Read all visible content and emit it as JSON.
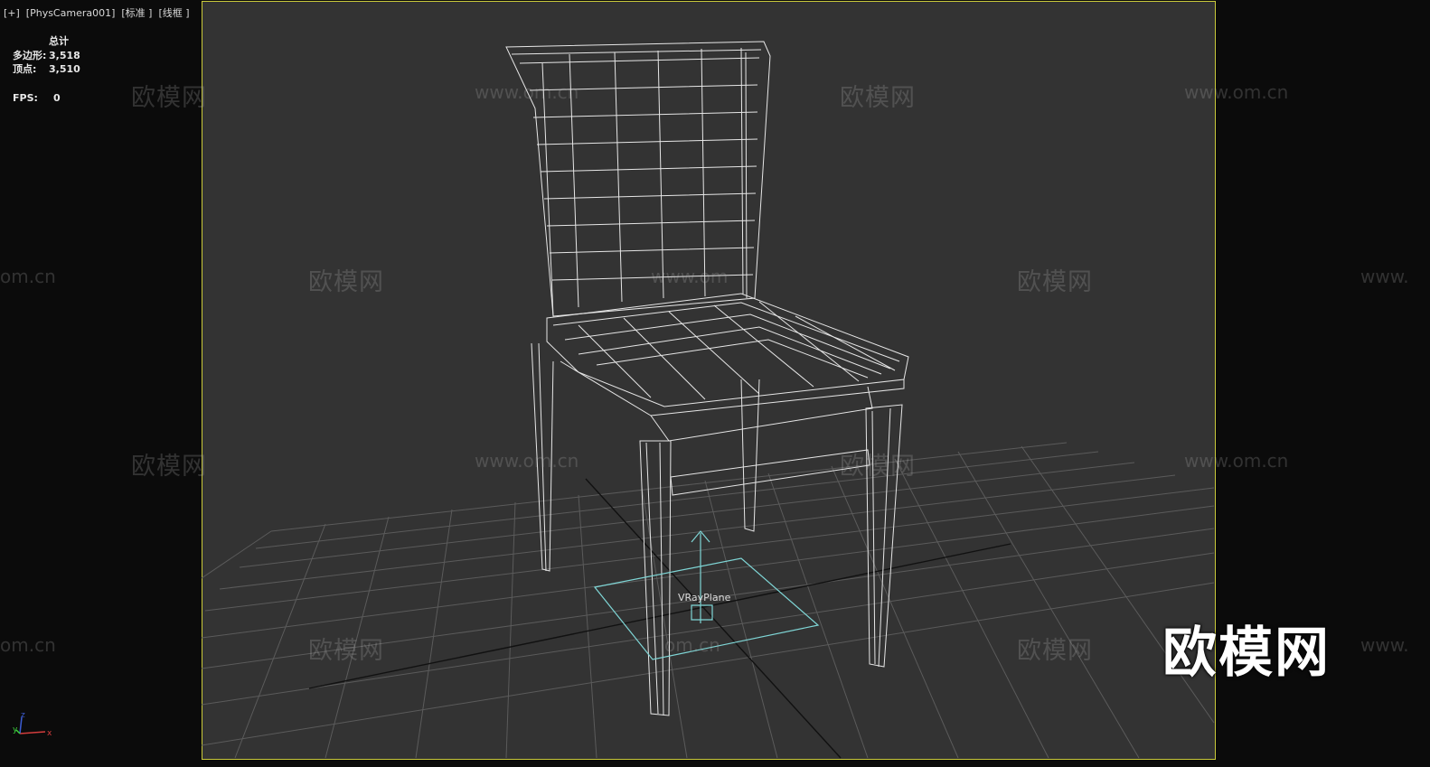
{
  "viewport": {
    "label": "[+]  [PhysCamera001]  [标准 ]  [线框 ]"
  },
  "stats": {
    "header": "总计",
    "polygons_label": "多边形:",
    "polygons_value": "3,518",
    "vertices_label": "顶点:",
    "vertices_value": "3,510",
    "fps_label": "FPS:",
    "fps_value": "0"
  },
  "scene": {
    "object_label": "VRayPlane",
    "axis_labels": {
      "x": "x",
      "y": "y",
      "z": "z"
    }
  },
  "watermarks": {
    "brand": "欧模网",
    "url": "www.om.cn",
    "url_fragment": "om.cn",
    "url_prefix": "www.",
    "url_mid": "www.om"
  },
  "colors": {
    "frame_border": "#c9c93a",
    "viewport_bg": "#333333",
    "wire": "#e6e6e6",
    "vray_plane": "#7fd6d6"
  }
}
